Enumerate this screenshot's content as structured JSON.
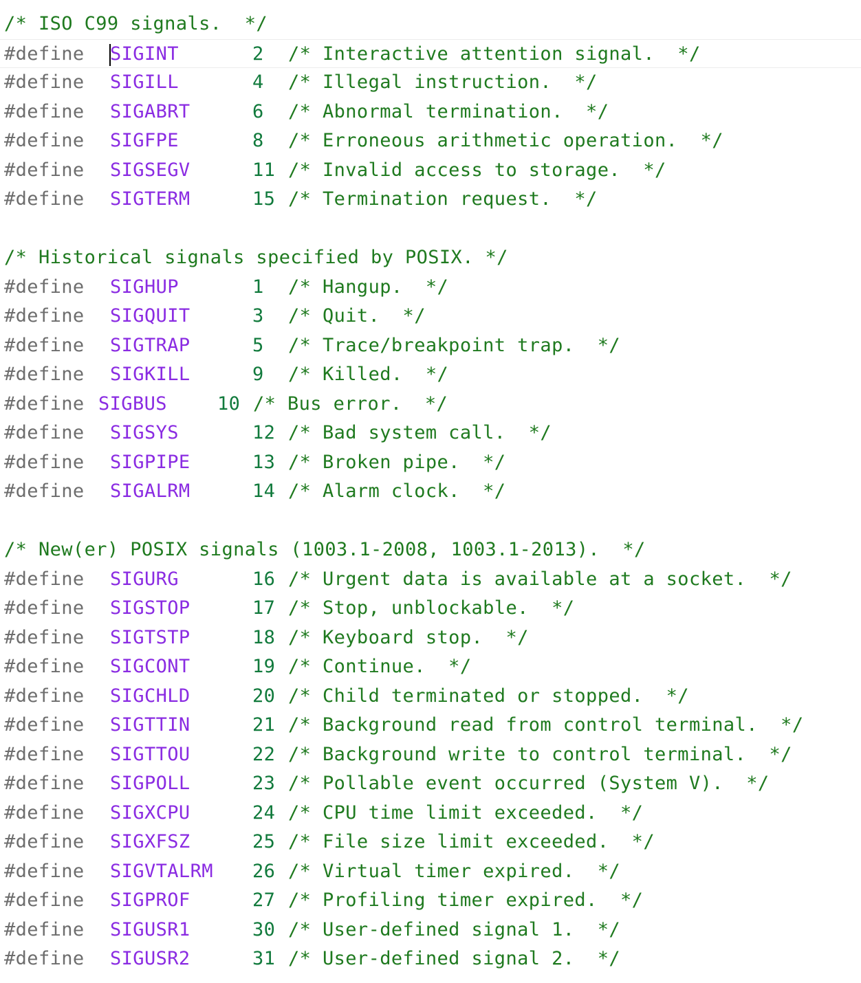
{
  "sections": [
    {
      "header": "/* ISO C99 signals.  */",
      "rows": [
        {
          "d": "#define",
          "name": "SIGINT",
          "num": "2",
          "comment": "/* Interactive attention signal.  */"
        },
        {
          "d": "#define",
          "name": "SIGILL",
          "num": "4",
          "comment": "/* Illegal instruction.  */"
        },
        {
          "d": "#define",
          "name": "SIGABRT",
          "num": "6",
          "comment": "/* Abnormal termination.  */"
        },
        {
          "d": "#define",
          "name": "SIGFPE",
          "num": "8",
          "comment": "/* Erroneous arithmetic operation.  */"
        },
        {
          "d": "#define",
          "name": "SIGSEGV",
          "num": "11",
          "comment": "/* Invalid access to storage.  */"
        },
        {
          "d": "#define",
          "name": "SIGTERM",
          "num": "15",
          "comment": "/* Termination request.  */"
        }
      ]
    },
    {
      "header": "/* Historical signals specified by POSIX. */",
      "rows": [
        {
          "d": "#define",
          "name": "SIGHUP",
          "num": "1",
          "comment": "/* Hangup.  */"
        },
        {
          "d": "#define",
          "name": "SIGQUIT",
          "num": "3",
          "comment": "/* Quit.  */"
        },
        {
          "d": "#define",
          "name": "SIGTRAP",
          "num": "5",
          "comment": "/* Trace/breakpoint trap.  */"
        },
        {
          "d": "#define",
          "name": "SIGKILL",
          "num": "9",
          "comment": "/* Killed.  */"
        },
        {
          "d": "#define",
          "name": "SIGBUS",
          "num": "10",
          "comment": "/* Bus error.  */"
        },
        {
          "d": "#define",
          "name": "SIGSYS",
          "num": "12",
          "comment": "/* Bad system call.  */"
        },
        {
          "d": "#define",
          "name": "SIGPIPE",
          "num": "13",
          "comment": "/* Broken pipe.  */"
        },
        {
          "d": "#define",
          "name": "SIGALRM",
          "num": "14",
          "comment": "/* Alarm clock.  */"
        }
      ]
    },
    {
      "header": "/* New(er) POSIX signals (1003.1-2008, 1003.1-2013).  */",
      "rows": [
        {
          "d": "#define",
          "name": "SIGURG",
          "num": "16",
          "comment": "/* Urgent data is available at a socket.  */"
        },
        {
          "d": "#define",
          "name": "SIGSTOP",
          "num": "17",
          "comment": "/* Stop, unblockable.  */"
        },
        {
          "d": "#define",
          "name": "SIGTSTP",
          "num": "18",
          "comment": "/* Keyboard stop.  */"
        },
        {
          "d": "#define",
          "name": "SIGCONT",
          "num": "19",
          "comment": "/* Continue.  */"
        },
        {
          "d": "#define",
          "name": "SIGCHLD",
          "num": "20",
          "comment": "/* Child terminated or stopped.  */"
        },
        {
          "d": "#define",
          "name": "SIGTTIN",
          "num": "21",
          "comment": "/* Background read from control terminal.  */"
        },
        {
          "d": "#define",
          "name": "SIGTTOU",
          "num": "22",
          "comment": "/* Background write to control terminal.  */"
        },
        {
          "d": "#define",
          "name": "SIGPOLL",
          "num": "23",
          "comment": "/* Pollable event occurred (System V).  */"
        },
        {
          "d": "#define",
          "name": "SIGXCPU",
          "num": "24",
          "comment": "/* CPU time limit exceeded.  */"
        },
        {
          "d": "#define",
          "name": "SIGXFSZ",
          "num": "25",
          "comment": "/* File size limit exceeded.  */"
        },
        {
          "d": "#define",
          "name": "SIGVTALRM",
          "num": "26",
          "comment": "/* Virtual timer expired.  */"
        },
        {
          "d": "#define",
          "name": "SIGPROF",
          "num": "27",
          "comment": "/* Profiling timer expired.  */"
        },
        {
          "d": "#define",
          "name": "SIGUSR1",
          "num": "30",
          "comment": "/* User-defined signal 1.  */"
        },
        {
          "d": "#define",
          "name": "SIGUSR2",
          "num": "31",
          "comment": "/* User-defined signal 2.  */"
        }
      ]
    }
  ],
  "colors": {
    "comment": "#1f7a1f",
    "directive": "#6d6d6d",
    "macro": "#8a2be2",
    "number": "#117a3c"
  }
}
